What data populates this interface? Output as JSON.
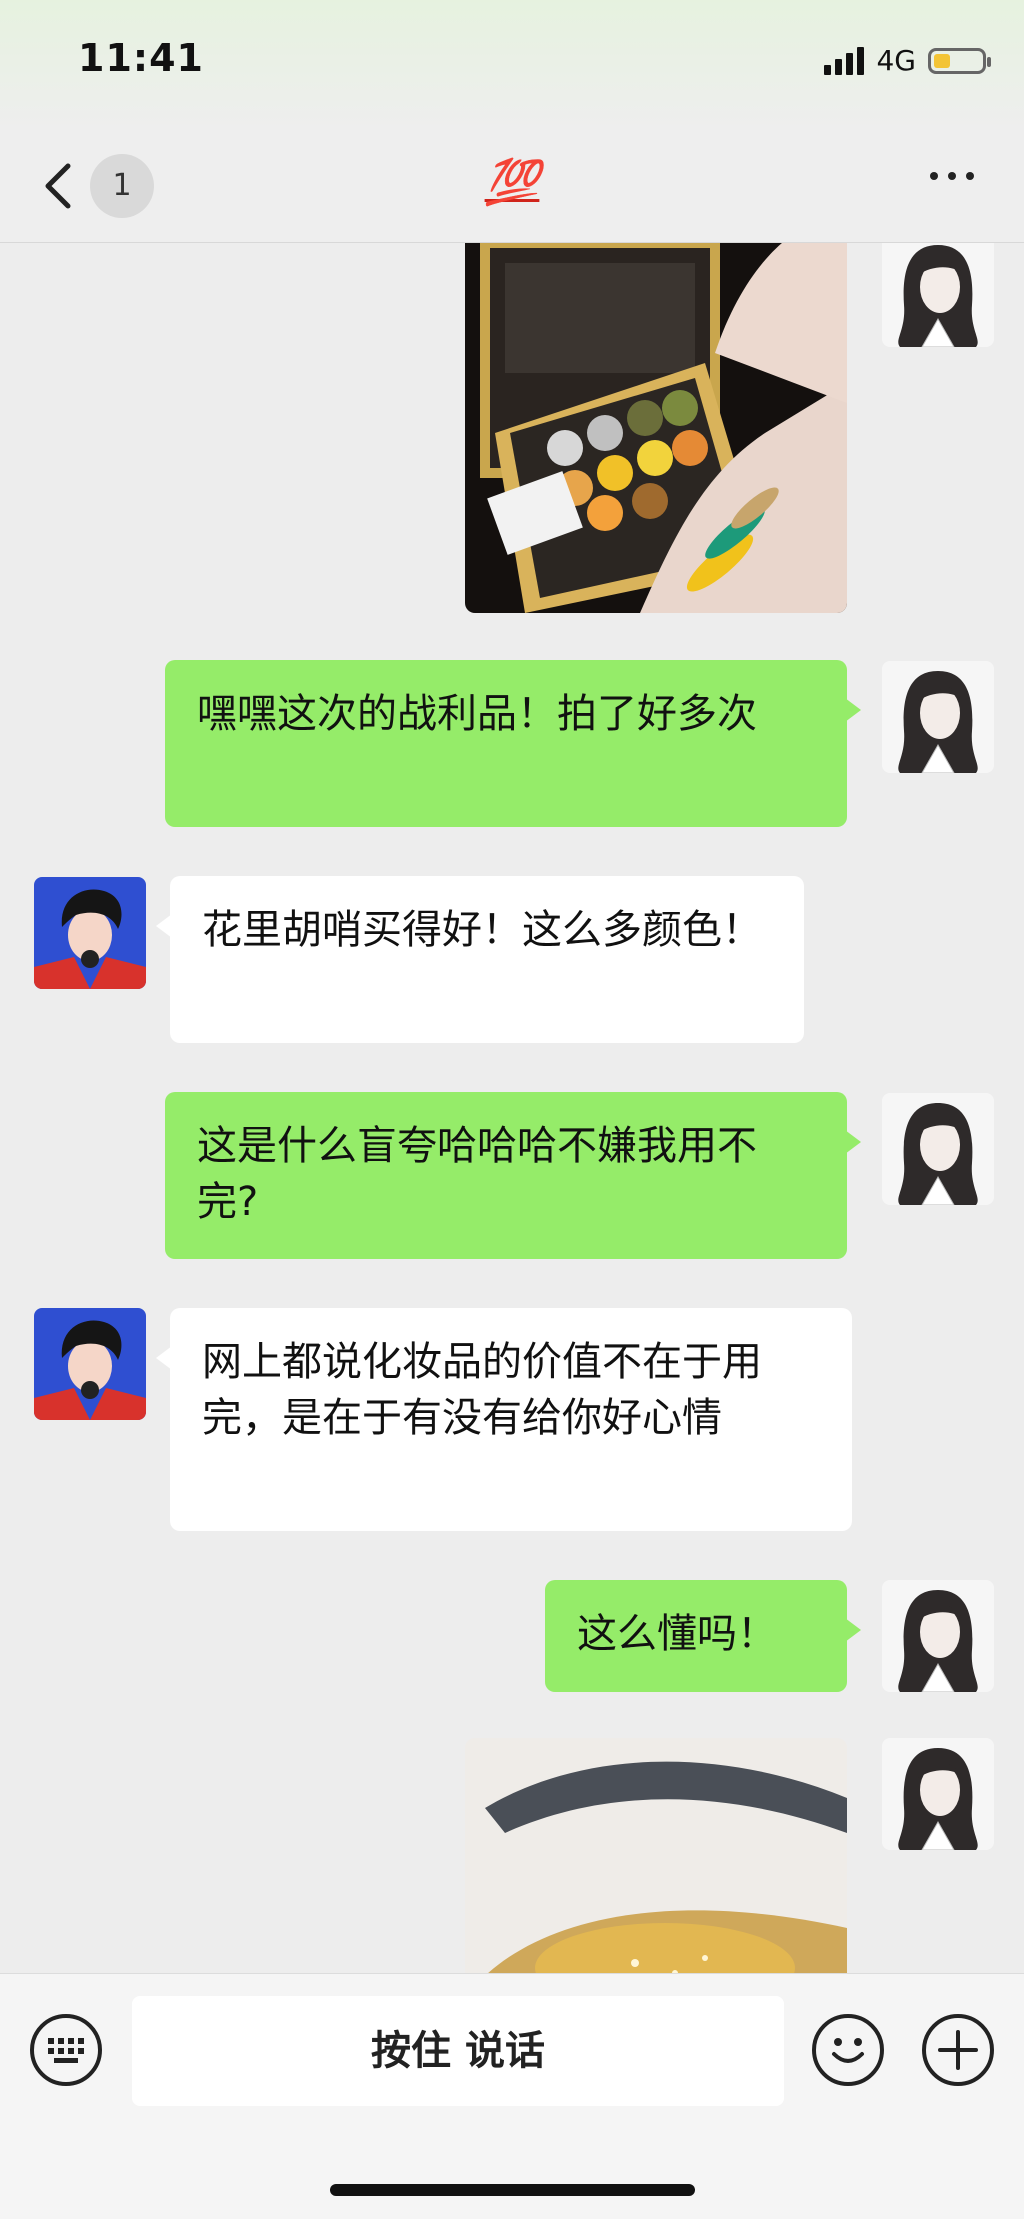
{
  "status_bar": {
    "time": "11:41",
    "network": "4G"
  },
  "nav": {
    "back_count": "1",
    "title": "💯"
  },
  "messages": [
    {
      "from": "me",
      "type": "image",
      "content": "palette-swatch-photo"
    },
    {
      "from": "me",
      "type": "text",
      "text": "嘿嘿这次的战利品！拍了好多次"
    },
    {
      "from": "them",
      "type": "text",
      "text": "花里胡哨买得好！这么多颜色！"
    },
    {
      "from": "me",
      "type": "text",
      "text": "这是什么盲夸哈哈哈不嫌我用不完?"
    },
    {
      "from": "them",
      "type": "text",
      "text": "网上都说化妆品的价值不在于用完，是在于有没有给你好心情"
    },
    {
      "from": "me",
      "type": "text",
      "text": "这么懂吗！"
    },
    {
      "from": "me",
      "type": "image",
      "content": "eye-makeup-photo"
    }
  ],
  "input_bar": {
    "voice_label": "按住 说话"
  },
  "colors": {
    "my_bubble": "#95ec69",
    "their_bubble": "#ffffff",
    "background": "#ededed"
  }
}
